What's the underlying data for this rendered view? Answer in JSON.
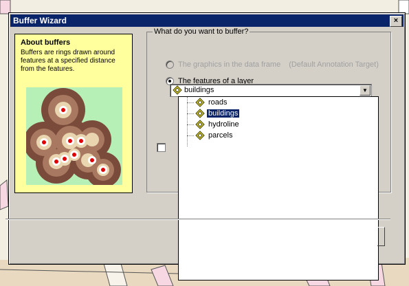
{
  "window": {
    "title": "Buffer Wizard",
    "close_label": "×"
  },
  "about": {
    "heading": "About buffers",
    "text": "Buffers are rings drawn around features at a specified distance from the features."
  },
  "question": "What do you want to buffer?",
  "options": {
    "graphics": "The graphics in the data frame",
    "graphics_note": "(Default Annotation Target)",
    "features": "The features of a layer"
  },
  "layer_select": {
    "selected": "buildings",
    "options": [
      "roads",
      "buildings",
      "hydroline",
      "parcels"
    ]
  },
  "colors": {
    "titlebar": "#0a246a",
    "about_bg": "#ffff9e",
    "highlight": "#0a246a"
  },
  "icons": {
    "layer": "layer-diamond-icon"
  }
}
